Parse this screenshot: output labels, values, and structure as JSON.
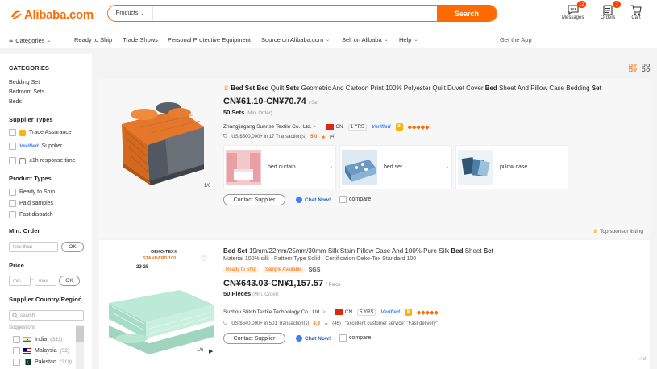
{
  "header": {
    "logo_text": "Alibaba.com",
    "search": {
      "category": "Products",
      "placeholder": "",
      "button": "Search"
    },
    "messages": {
      "label": "Messages",
      "badge": "12"
    },
    "orders": {
      "label": "Orders",
      "badge": "1"
    },
    "cart": {
      "label": "Cart"
    }
  },
  "nav": {
    "categories": "Categories",
    "items": [
      "Ready to Ship",
      "Trade Shows",
      "Personal Protective Equipment",
      "Source on Alibaba.com",
      "Sell on Alibaba",
      "Help"
    ],
    "get_app": "Get the App"
  },
  "sidebar": {
    "categories_heading": "CATEGORIES",
    "categories": [
      "Bedding Set",
      "Bedroom Sets",
      "Beds"
    ],
    "supplier_types_heading": "Supplier Types",
    "trade_assurance": "Trade Assurance",
    "verified": "Verified",
    "supplier_label": "Supplier",
    "response_time": "≤1h response time",
    "product_types_heading": "Product Types",
    "product_types": [
      "Ready to Ship",
      "Paid samples",
      "Fast dispatch"
    ],
    "min_order_heading": "Min. Order",
    "less_than_placeholder": "less than",
    "ok": "OK",
    "price_heading": "Price",
    "min_placeholder": "min",
    "price_dash": "-",
    "max_placeholder": "max",
    "country_heading": "Supplier Country/Region",
    "country_search_placeholder": "search",
    "suggestions": "Suggestions",
    "countries": [
      {
        "name": "India",
        "count": "(333)"
      },
      {
        "name": "Malaysia",
        "count": "(52)"
      },
      {
        "name": "Pakistan",
        "count": "(219)"
      }
    ]
  },
  "products": [
    {
      "title_parts": [
        [
          "Bed Set",
          true
        ],
        [
          " ",
          false
        ],
        [
          "Bed",
          true
        ],
        [
          " Quilt ",
          false
        ],
        [
          "Sets",
          true
        ],
        [
          " Geometric And Cartoon Print 100% Polyester Quilt Duvet Cover ",
          false
        ],
        [
          "Bed",
          true
        ],
        [
          " Sheet And Pillow Case Bedding ",
          false
        ],
        [
          "Set",
          true
        ]
      ],
      "price": "CN¥61.10-CN¥70.74",
      "price_unit": "/ Set",
      "moq": "50 Sets",
      "moq_note": "(Min. Order)",
      "supplier": "Zhangjiagang Sunrise Textile Co., Ltd.",
      "supplier_arrow": ">",
      "country": "CN",
      "years": "1 YRS",
      "verified": "Verified",
      "gold_mark": "♛",
      "diamonds": "◆◆◆◆◆",
      "transactions": "US $500,000+ in 17 Transaction(s)",
      "rating": "5.0",
      "star": "★",
      "reviews": "(4)",
      "img_counter": "1/6",
      "related": [
        {
          "label": "bed curtain"
        },
        {
          "label": "bed set"
        },
        {
          "label": "pillow case"
        }
      ],
      "related_arrow": "›",
      "contact": "Contact Supplier",
      "chat": "Chat Now!",
      "compare": "compare",
      "sponsor": "Top sponsor listing"
    },
    {
      "title_parts": [
        [
          "Bed Set",
          true
        ],
        [
          " 19mm/22mm/25mm/30mm Silk Stain Pillow Case And 100% Pure Silk ",
          false
        ],
        [
          "Bed",
          true
        ],
        [
          " Sheet ",
          false
        ],
        [
          "Set",
          true
        ]
      ],
      "subtitle": "Material 100% silk · Pattern Type Solid · Certification Oeko-Tex Standard 100",
      "tags": [
        "Ready to Ship",
        "Sample Available"
      ],
      "sgs": "SGS",
      "price": "CN¥643.03-CN¥1,157.57",
      "price_unit": "/ Piece",
      "moq": "50 Pieces",
      "moq_note": "(Min. Order)",
      "supplier": "Suzhou Stitch Textile Technology Co., Ltd.",
      "supplier_arrow": ">",
      "country": "CN",
      "years": "5 YRS",
      "verified": "Verified",
      "gold_mark": "♛",
      "diamonds": "◆◆◆◆◆",
      "transactions": "US $640,000+ in 501 Transaction(s)",
      "rating": "4.9",
      "star": "★",
      "reviews": "(46)",
      "quotes": "\"excellent customer service\"   \"Fast delivery\"",
      "img_counter": "1/6",
      "oeko_badge": "OEKO-TEX®",
      "oeko_sub": "STANDARD 100",
      "sizes": "22-25",
      "contact": "Contact Supplier",
      "chat": "Chat Now!",
      "compare": "compare",
      "ad": "Ad"
    }
  ],
  "colors": {
    "accent": "#ff6a00",
    "verified": "#3d7eff",
    "gold": "#f7b500"
  }
}
